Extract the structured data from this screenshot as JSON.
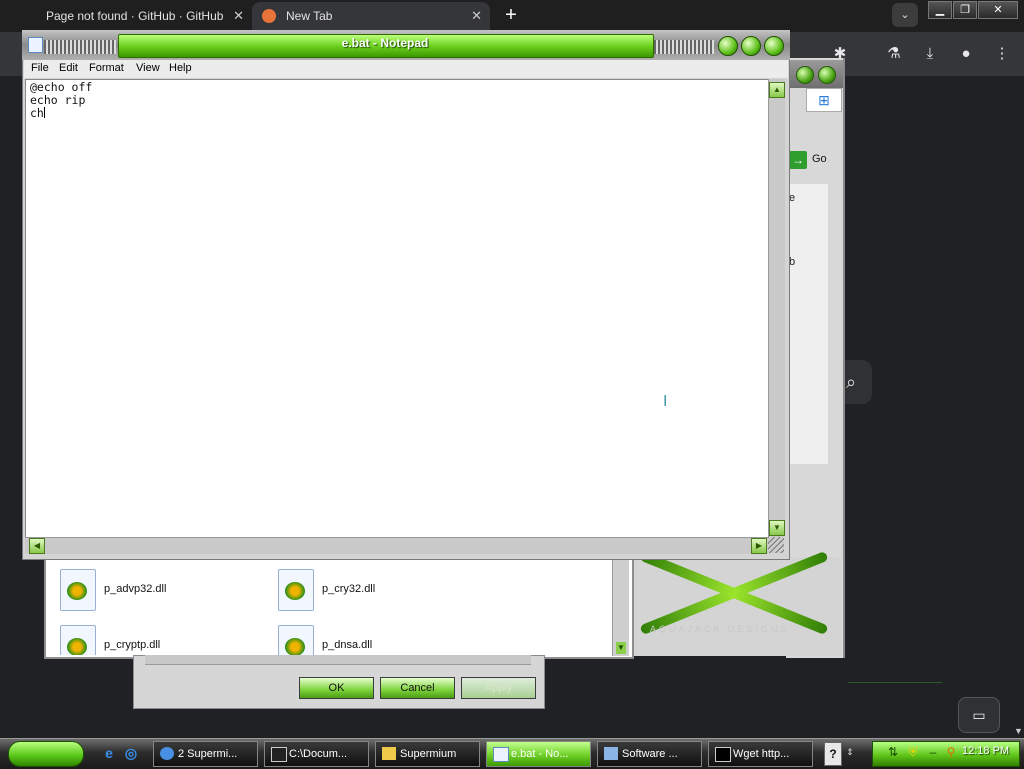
{
  "browser": {
    "tabs": [
      {
        "label": "Page not found · GitHub · GitHub"
      },
      {
        "label": "New Tab"
      }
    ],
    "new_tab": "+",
    "tab_search": "⌄",
    "window_controls": {
      "minimize": "▁",
      "maximize": "❐",
      "close": "✕"
    },
    "toolbar_icons": [
      "extensions-icon",
      "labs-flask-icon",
      "download-icon",
      "profile-icon",
      "more-menu-icon"
    ]
  },
  "notepad": {
    "title": "e.bat - Notepad",
    "menu": [
      "File",
      "Edit",
      "Format",
      "View",
      "Help"
    ],
    "content": "@echo off\necho rip\nch"
  },
  "background_window": {
    "go_label": "Go",
    "fragment_1": "e",
    "fragment_2": "b",
    "art_text": "AQUAJACK DESIGNS"
  },
  "files": [
    {
      "name": "p_advp32.dll"
    },
    {
      "name": "p_cry32.dll"
    },
    {
      "name": "p_cryptp.dll"
    },
    {
      "name": "p_dnsa.dll"
    }
  ],
  "dialog": {
    "ok": "OK",
    "cancel": "Cancel",
    "apply": "Apply"
  },
  "taskbar": {
    "tasks": [
      {
        "label": "2 Supermi...",
        "active": false
      },
      {
        "label": "C:\\Docum...",
        "active": false
      },
      {
        "label": "Supermium",
        "active": false
      },
      {
        "label": "e.bat - No...",
        "active": true
      },
      {
        "label": "Software ...",
        "active": false
      },
      {
        "label": "Wget http...",
        "active": false
      }
    ],
    "help": "?",
    "clock": "12:18 PM"
  },
  "colors": {
    "accent_green": "#5cc91a",
    "browser_dark": "#202124"
  }
}
